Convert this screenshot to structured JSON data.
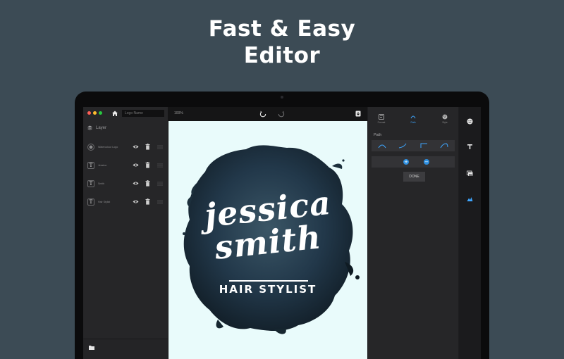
{
  "marketing": {
    "headline_line1": "Fast & Easy",
    "headline_line2": "Editor"
  },
  "sidebar": {
    "logo_name_placeholder": "Logo Name",
    "layer_title": "Layer",
    "layers": [
      {
        "name": "Watercolour Logo",
        "thumb_icon": "image-icon"
      },
      {
        "name": "Jessica",
        "thumb_icon": "text-icon",
        "glyph": "T"
      },
      {
        "name": "Smith",
        "thumb_icon": "text-icon",
        "glyph": "T"
      },
      {
        "name": "Hair Stylist",
        "thumb_icon": "text-icon",
        "glyph": "T"
      }
    ]
  },
  "canvas": {
    "zoom": "100%",
    "background_color": "#e9fbfb",
    "logo": {
      "line1": "jessica",
      "line2": "smith",
      "tagline": "HAIR STYLIST",
      "blob_color": "#1f3340"
    }
  },
  "text_tools": {
    "tabs": [
      {
        "label": "Format",
        "icon": "format-icon"
      },
      {
        "label": "Path",
        "icon": "curve-icon",
        "active": true
      },
      {
        "label": "Style",
        "icon": "palette-icon"
      }
    ],
    "path_title": "Path",
    "path_options": [
      "arc-up",
      "rise",
      "corner",
      "arc-right"
    ],
    "plus": "+",
    "minus": "−",
    "done_label": "DONE"
  },
  "tool_rail": [
    "smiley-icon",
    "text-icon",
    "image-icon",
    "shape-icon"
  ],
  "colors": {
    "page_bg": "#3c4b55",
    "accent": "#3ea6ff"
  }
}
